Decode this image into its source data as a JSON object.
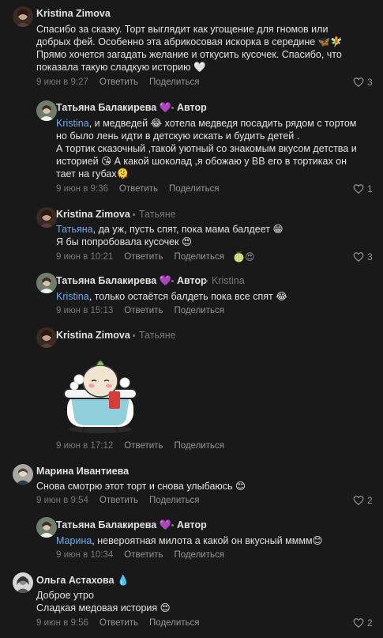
{
  "comments": [
    {
      "author": "Kristina Zimova",
      "lines": [
        "Спасибо за сказку. Торт выглядит как угощение для гномов или",
        "добрых фей. Особенно эта абрикосовая искорка в середине 🦋🧚",
        "Прямо хочется загадать желание и откусить кусочек. Спасибо, что",
        "показала такую сладкую историю 🤍"
      ],
      "time": "9 июн в 9:27",
      "reply": "Ответить",
      "share": "Поделиться",
      "likes": "3"
    },
    {
      "author": "Татьяна Балакирева",
      "author_emoji": "💜",
      "badge": "Автор",
      "mention": "Kristina",
      "lines": [
        ", и медведей 😂 хотела медведя посадить рядом с тортом",
        "но было лень идти в детскую искать и будить детей .",
        "А тортик сказочный ,такой уютный со знакомым вкусом детства и",
        "историей 😘  А какой шоколад ,я обожаю у ВВ его в тортиках он",
        "тает на губах🫠"
      ],
      "time": "9 июн в 9:36",
      "reply": "Ответить",
      "share": "Поделиться",
      "likes": "1"
    },
    {
      "author": "Kristina Zimova",
      "reply_to": "Татьяне",
      "mention": "Татьяна",
      "lines": [
        ", да уж, пусть спят, пока мама балдеет 😁",
        "Я бы попробовала кусочек 😍"
      ],
      "time": "9 июн в 10:21",
      "reply": "Ответить",
      "share": "Поделиться",
      "reactions": "🍈😍",
      "likes": "3"
    },
    {
      "author": "Татьяна Балакирева",
      "author_emoji": "💜",
      "badge": "Автор",
      "reply_to": "Kristina",
      "mention": "Kristina",
      "lines": [
        ", только остаётся балдеть пока все спят 😂"
      ],
      "time": "9 июн в 15:13",
      "reply": "Ответить",
      "share": "Поделиться"
    },
    {
      "author": "Kristina Zimova",
      "reply_to": "Татьяне",
      "time": "9 июн в 17:12",
      "reply": "Ответить",
      "share": "Поделиться"
    },
    {
      "author": "Марина Ивантиева",
      "lines": [
        "Снова смотрю этот торт и снова улыбаюсь 😊"
      ],
      "time": "9 июн в 9:54",
      "reply": "Ответить",
      "share": "Поделиться",
      "likes": "2"
    },
    {
      "author": "Татьяна Балакирева",
      "author_emoji": "💜",
      "badge": "Автор",
      "mention": "Марина",
      "lines": [
        ", невероятная милота а какой он вкусный мммм😊"
      ],
      "time": "9 июн в 10:34",
      "reply": "Ответить",
      "share": "Поделиться"
    },
    {
      "author": "Ольга Астахова",
      "author_emoji": "💧",
      "lines": [
        "Доброе утро",
        "Сладкая медовая история 😍"
      ],
      "time": "9 июн в 9:56",
      "reply": "Ответить",
      "share": "Поделиться",
      "likes": "2"
    }
  ],
  "colors": {
    "background": "#19191a",
    "text": "#e1e3e6",
    "secondary": "#76787a",
    "mention": "#71aaeb"
  }
}
